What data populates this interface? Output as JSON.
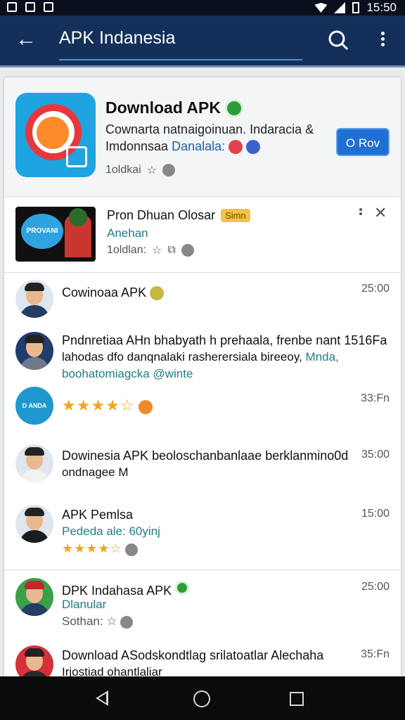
{
  "status": {
    "time": "15:50"
  },
  "appbar": {
    "title": "APK Indanesia"
  },
  "hero": {
    "name": "Download APK",
    "desc1": "Cownarta natnaigoinuan. Indaracia &",
    "desc2_prefix": "Imdonnsaa",
    "desc2_accent": "Danalala:",
    "meta": "1oldkai",
    "button": "O Rov"
  },
  "ad": {
    "thumb_text": "PROVANI",
    "name": "Pron Dhuan Olosar",
    "badge": "Simn",
    "sub": "Anehan",
    "meta": "1oldlan:"
  },
  "rows": [
    {
      "title": "Cowinoaa APK",
      "time": "25:00"
    },
    {
      "title": "Pndnretiaa AHn bhabyath h prehaala, frenbe nant 1516Fa",
      "line2": "lahodas dfo danqnalaki rasherersiala bireeoy,",
      "line2_accent": "Mnda,",
      "line3": "boohatomiagcka @winte",
      "time": ""
    },
    {
      "avatar_text": "D ANDA",
      "time": "33:Fn"
    },
    {
      "title": "Dowinesia APK beoloschanbanlaae  berklanmino0d",
      "line2": "ondnagee M",
      "time": "35:00"
    },
    {
      "title": "APK Pemlsa",
      "line2": "Pededa  ale: 60yinj",
      "time": "15:00"
    },
    {
      "title": "DPK Indahasa APK",
      "line2": "Dlanular",
      "line3": "Sothan:",
      "time": "25:00"
    },
    {
      "title": "Download ASodskondtlag srilatoatlar Alechaha",
      "line2": "Irjostiad ohantlaliar",
      "time": "35:Fn"
    }
  ],
  "colors": {
    "appbar": "#14305a",
    "accent": "#1f6fd4",
    "star": "#f2a51e",
    "verified": "#2e9c3a"
  }
}
